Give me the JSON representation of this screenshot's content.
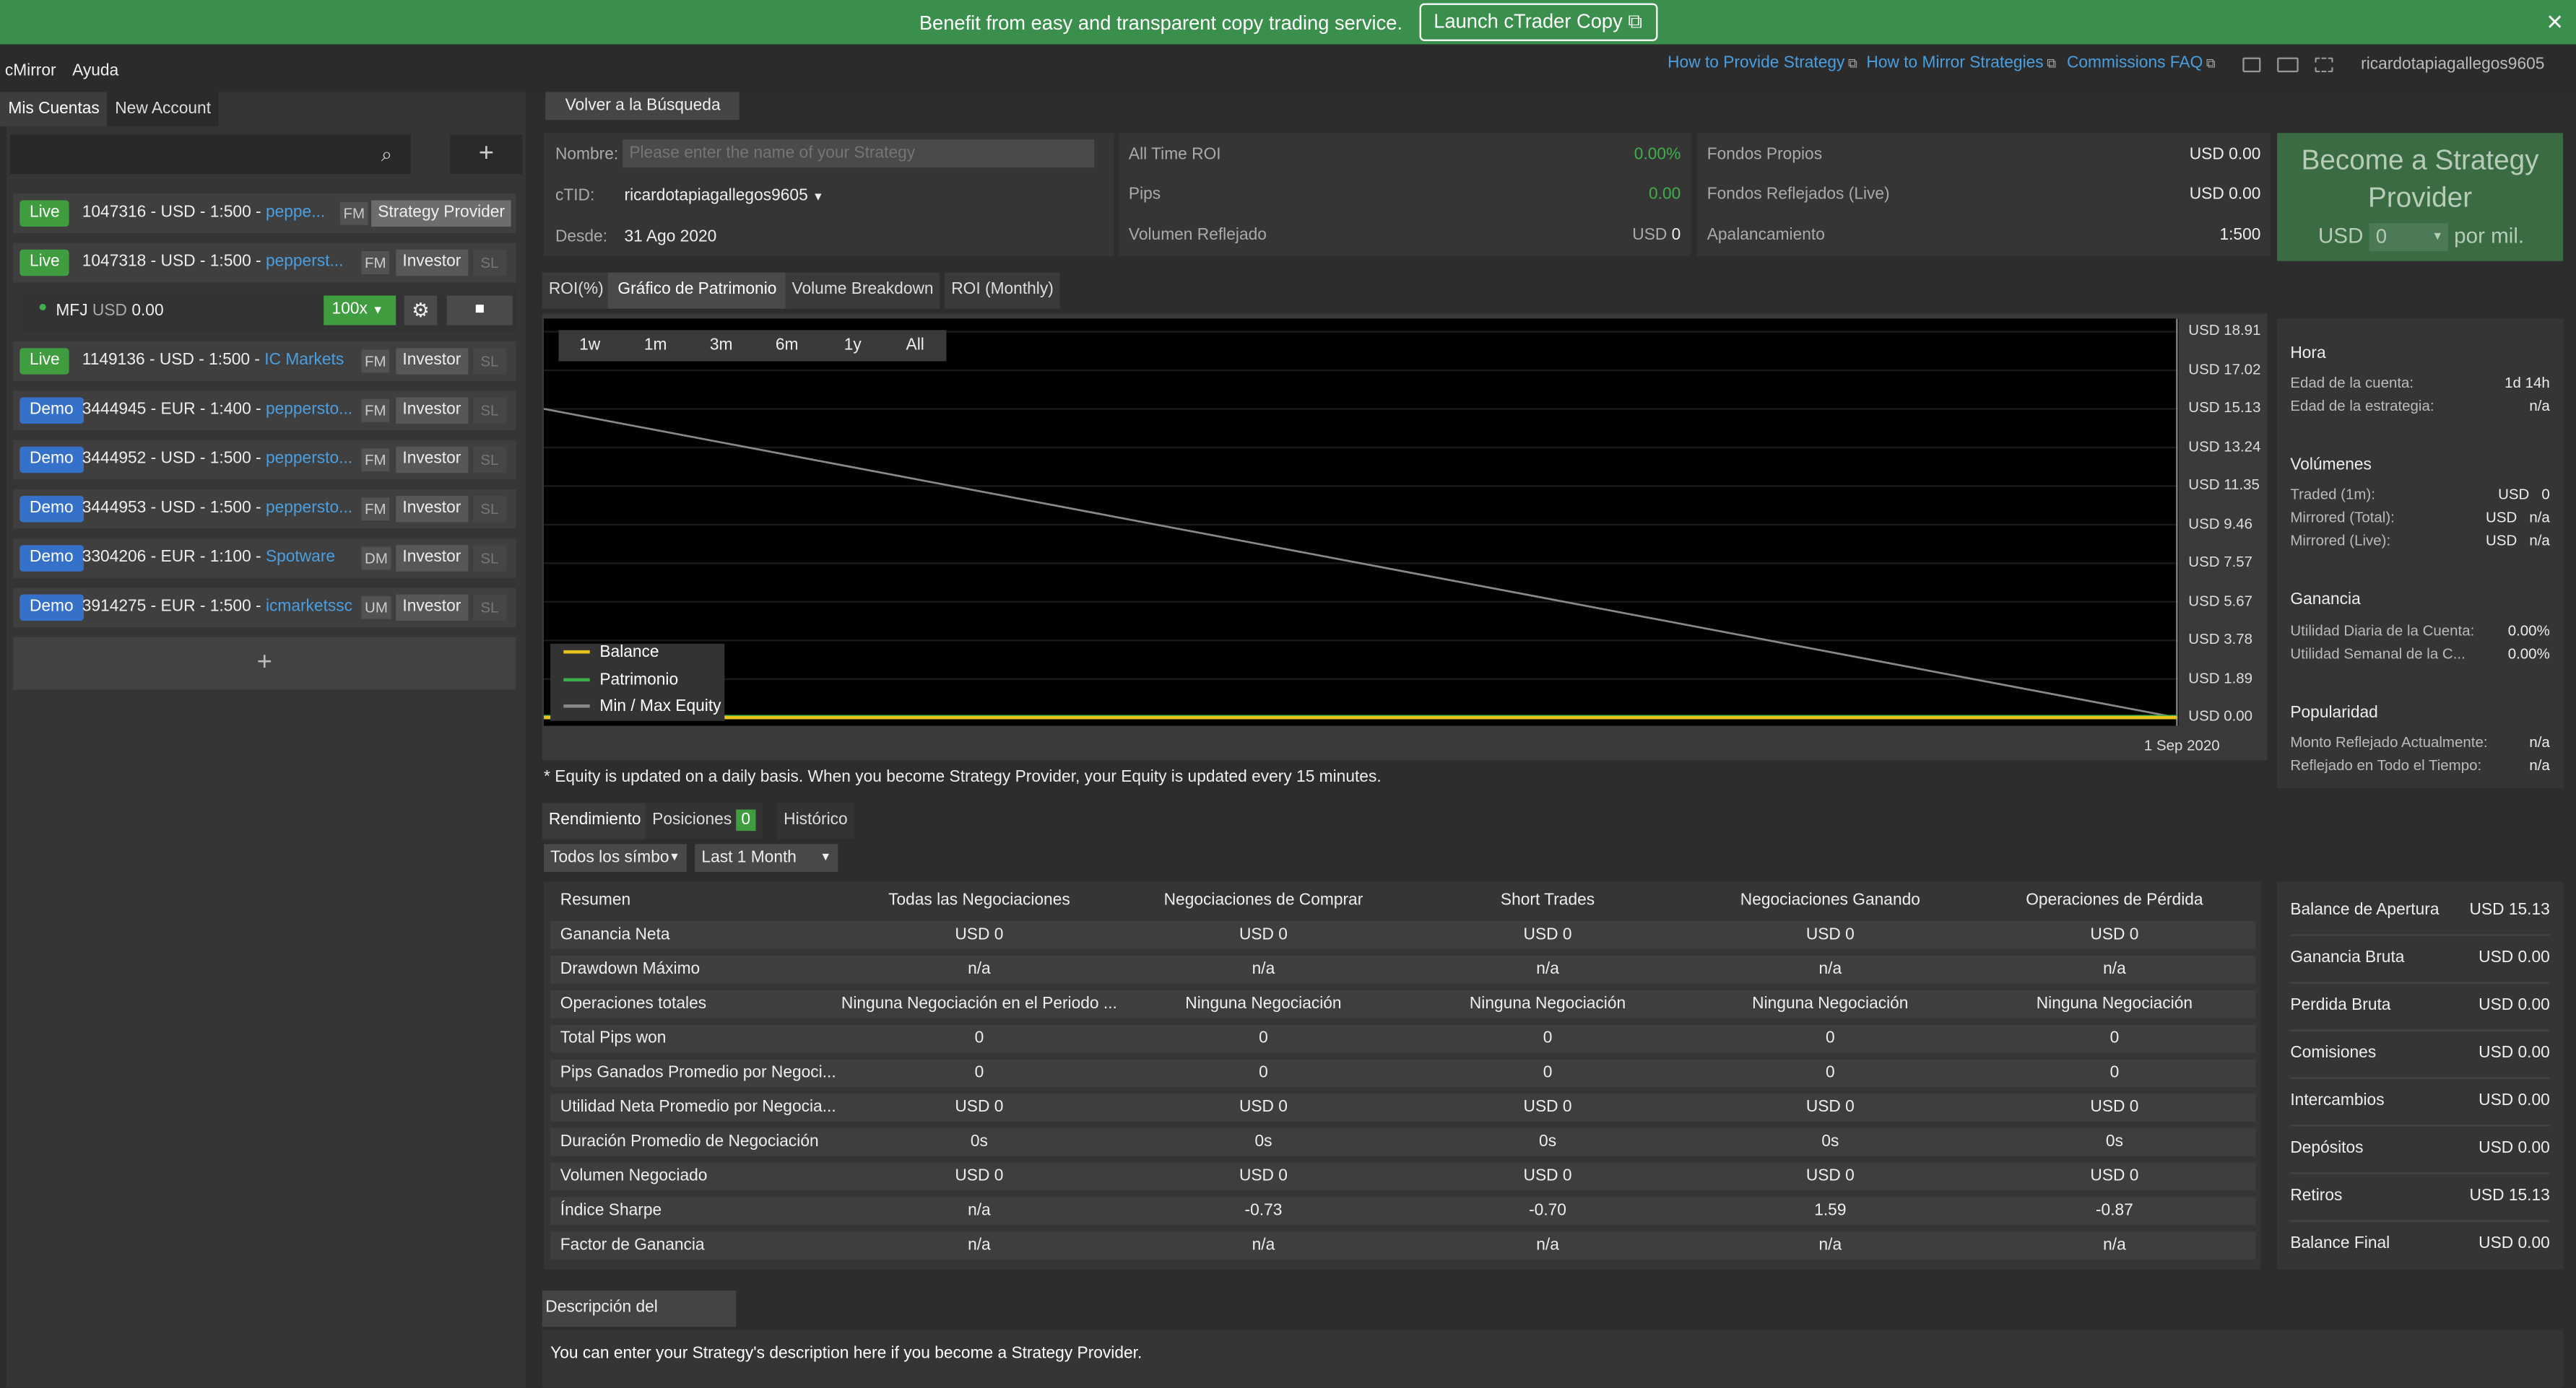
{
  "banner": {
    "text": "Benefit from easy and transparent copy trading service.",
    "button": "Launch cTrader Copy",
    "close": "×"
  },
  "menu": {
    "app": "cMirror",
    "help": "Ayuda"
  },
  "toplinks": [
    "How to Provide Strategy",
    "How to Mirror Strategies",
    "Commissions FAQ"
  ],
  "username": "ricardotapiagallegos9605",
  "left": {
    "tabs": [
      "Mis Cuentas",
      "New Account"
    ],
    "add": "+",
    "accounts": [
      {
        "type": "Live",
        "num": "1047316 - USD - 1:500 - ",
        "broker": "peppe...",
        "fm": "FM",
        "role": "Strategy Provider",
        "sl": ""
      },
      {
        "type": "Live",
        "num": "1047318 - USD - 1:500 - ",
        "broker": "pepperst...",
        "fm": "FM",
        "role": "Investor",
        "sl": "SL"
      },
      {
        "type": "Live",
        "num": "1149136 - USD - 1:500 - ",
        "broker": "IC Markets",
        "fm": "FM",
        "role": "Investor",
        "sl": "SL"
      },
      {
        "type": "Demo",
        "num": "3444945 - EUR - 1:400 - ",
        "broker": "peppersto...",
        "fm": "FM",
        "role": "Investor",
        "sl": "SL"
      },
      {
        "type": "Demo",
        "num": "3444952 - USD - 1:500 - ",
        "broker": "peppersto...",
        "fm": "FM",
        "role": "Investor",
        "sl": "SL"
      },
      {
        "type": "Demo",
        "num": "3444953 - USD - 1:500 - ",
        "broker": "peppersto...",
        "fm": "FM",
        "role": "Investor",
        "sl": "SL"
      },
      {
        "type": "Demo",
        "num": "3304206 - EUR - 1:100 - ",
        "broker": "Spotware",
        "fm": "DM",
        "role": "Investor",
        "sl": "SL"
      },
      {
        "type": "Demo",
        "num": "3914275 - EUR - 1:500 - ",
        "broker": "icmarketssc",
        "fm": "UM",
        "role": "Investor",
        "sl": "SL"
      }
    ],
    "mfj": {
      "name": "MFJ",
      "cur": "USD",
      "val": "0.00",
      "mult": "100x"
    },
    "add_bottom": "+"
  },
  "back": "Volver a la Búsqueda",
  "info": {
    "nombre_label": "Nombre:",
    "nombre_placeholder": "Please enter the name of your Strategy",
    "ctid_label": "cTID:",
    "ctid_value": "ricardotapiagallegos9605",
    "desde_label": "Desde:",
    "desde_value": "31 Ago 2020",
    "roi_label": "All Time ROI",
    "roi_value": "0.00%",
    "pips_label": "Pips",
    "pips_value": "0.00",
    "vol_label": "Volumen Reflejado",
    "vol_cur": "USD",
    "vol_value": "0",
    "fondos_label": "Fondos Propios",
    "fondos_value": "USD 0.00",
    "fondosr_label": "Fondos Reflejados (Live)",
    "fondosr_value": "USD 0.00",
    "apal_label": "Apalancamiento",
    "apal_value": "1:500"
  },
  "provider": {
    "title": "Become a Strategy Provider",
    "cur": "USD",
    "fee": "0",
    "suffix": "por mil."
  },
  "chart_tabs": [
    "ROI(%)",
    "Gráfico de Patrimonio",
    "Volume Breakdown",
    "ROI (Monthly)"
  ],
  "ranges": [
    "1w",
    "1m",
    "3m",
    "6m",
    "1y",
    "All"
  ],
  "chart_data": {
    "type": "line",
    "x": [
      "",
      "1 Sep 2020"
    ],
    "yticks": [
      "USD 18.91",
      "USD 17.02",
      "USD 15.13",
      "USD 13.24",
      "USD 11.35",
      "USD 9.46",
      "USD 7.57",
      "USD 5.67",
      "USD 3.78",
      "USD 1.89",
      "USD 0.00"
    ],
    "ylim": [
      0,
      18.91
    ],
    "series": [
      {
        "name": "Balance",
        "color": "#e8c21c",
        "values": [
          0,
          0
        ]
      },
      {
        "name": "Patrimonio",
        "color": "#3eb04b",
        "values": [
          0,
          0
        ]
      },
      {
        "name": "Min / Max Equity",
        "color": "#888888",
        "values": [
          15.13,
          0
        ]
      }
    ]
  },
  "footnote": "* Equity is updated on a daily basis. When you become Strategy Provider, your Equity is updated every 15 minutes.",
  "stats": {
    "hora": "Hora",
    "edad_cuenta": "Edad de la cuenta:",
    "edad_cuenta_v": "1d 14h",
    "edad_estr": "Edad de la estrategia:",
    "edad_estr_v": "n/a",
    "volumenes": "Volúmenes",
    "traded": "Traded (1m):",
    "traded_v": "USD   0",
    "mirr_total": "Mirrored (Total):",
    "mirr_total_v": "USD   n/a",
    "mirr_live": "Mirrored (Live):",
    "mirr_live_v": "USD   n/a",
    "ganancia": "Ganancia",
    "util_diaria": "Utilidad Diaria de la Cuenta:",
    "util_diaria_v": "0.00%",
    "util_semanal": "Utilidad Semanal de la C...",
    "util_semanal_v": "0.00%",
    "popularidad": "Popularidad",
    "monto": "Monto Reflejado Actualmente:",
    "monto_v": "n/a",
    "reflejado": "Reflejado en Todo el Tiempo:",
    "reflejado_v": "n/a"
  },
  "perf_tabs": {
    "rend": "Rendimiento",
    "pos": "Posiciones",
    "pos_count": "0",
    "hist": "Histórico"
  },
  "filters": {
    "symbol": "Todos los símbo",
    "period": "Last 1 Month"
  },
  "table": {
    "headers": [
      "Resumen",
      "Todas las Negociaciones",
      "Negociaciones de Comprar",
      "Short Trades",
      "Negociaciones Ganando",
      "Operaciones de Pérdida"
    ],
    "rows": [
      [
        "Ganancia Neta",
        "USD 0",
        "USD 0",
        "USD 0",
        "USD 0",
        "USD 0"
      ],
      [
        "Drawdown Máximo",
        "n/a",
        "n/a",
        "n/a",
        "n/a",
        "n/a"
      ],
      [
        "Operaciones totales",
        "Ninguna Negociación en el Periodo ...",
        "Ninguna Negociación",
        "Ninguna Negociación",
        "Ninguna Negociación",
        "Ninguna Negociación"
      ],
      [
        "Total Pips won",
        "0",
        "0",
        "0",
        "0",
        "0"
      ],
      [
        "Pips Ganados Promedio por Negoci...",
        "0",
        "0",
        "0",
        "0",
        "0"
      ],
      [
        "Utilidad Neta Promedio por Negocia...",
        "USD 0",
        "USD 0",
        "USD 0",
        "USD 0",
        "USD 0"
      ],
      [
        "Duración Promedio de Negociación",
        "0s",
        "0s",
        "0s",
        "0s",
        "0s"
      ],
      [
        "Volumen Negociado",
        "USD 0",
        "USD 0",
        "USD 0",
        "USD 0",
        "USD 0"
      ],
      [
        "Índice Sharpe",
        "n/a",
        "-0.73",
        "-0.70",
        "1.59",
        "-0.87"
      ],
      [
        "Factor de Ganancia",
        "n/a",
        "n/a",
        "n/a",
        "n/a",
        "n/a"
      ]
    ]
  },
  "balances": [
    [
      "Balance de Apertura",
      "USD 15.13"
    ],
    [
      "Ganancia Bruta",
      "USD 0.00"
    ],
    [
      "Perdida Bruta",
      "USD 0.00"
    ],
    [
      "Comisiones",
      "USD 0.00"
    ],
    [
      "Intercambios",
      "USD 0.00"
    ],
    [
      "Depósitos",
      "USD 0.00"
    ],
    [
      "Retiros",
      "USD 15.13"
    ],
    [
      "Balance Final",
      "USD 0.00"
    ]
  ],
  "desc": {
    "tab": "Descripción del Proveedor",
    "text": "You can enter your Strategy's description here if you become a Strategy Provider."
  }
}
